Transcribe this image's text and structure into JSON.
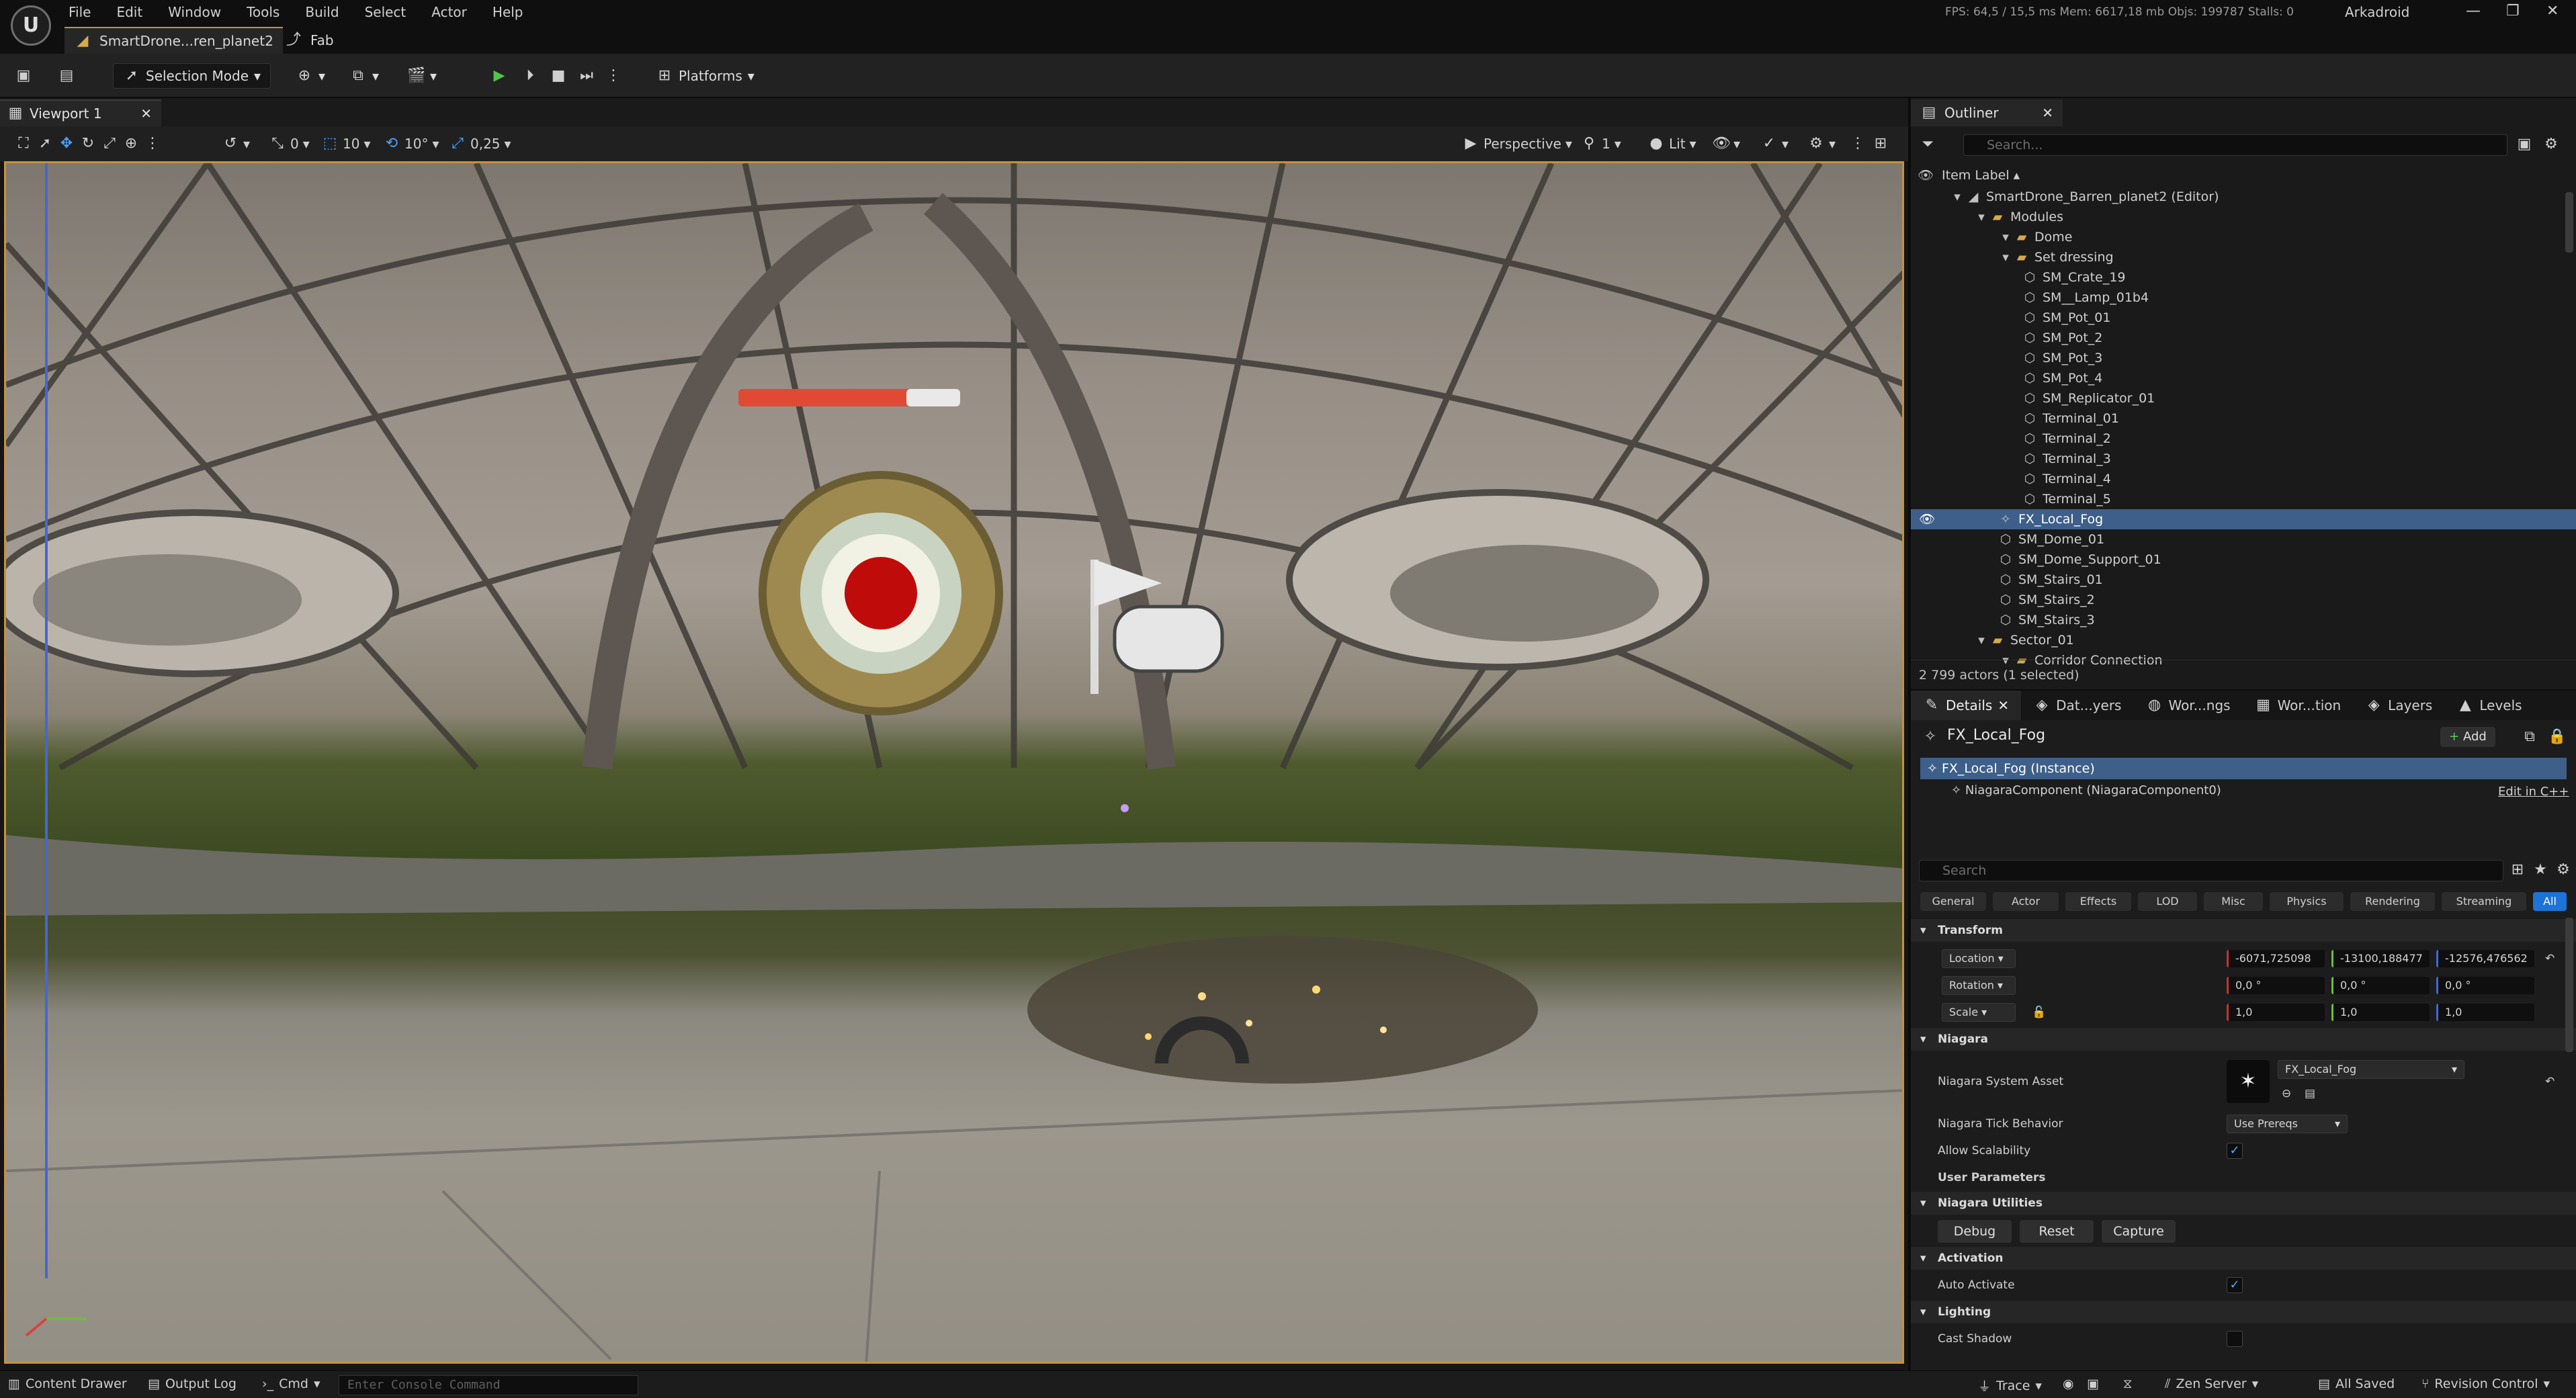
{
  "app": {
    "logo_letter": "U",
    "project": "Arkadroid",
    "stats": "FPS: 64,5  /  15,5 ms  Mem: 6617,18 mb  Objs: 199787  Stalls: 0"
  },
  "menu": [
    "File",
    "Edit",
    "Window",
    "Tools",
    "Build",
    "Select",
    "Actor",
    "Help"
  ],
  "doc_tabs": [
    "SmartDrone...ren_planet2",
    "Fab"
  ],
  "toolbar": {
    "selection_mode": "Selection Mode",
    "platforms": "Platforms"
  },
  "viewport": {
    "tab_label": "Viewport 1",
    "grid_snap": "10",
    "rotation_snap": "10°",
    "scale_snap": "0,25",
    "camera_speed": "1",
    "perspective": "Perspective",
    "lit": "Lit",
    "angle_value": "0"
  },
  "outliner": {
    "tab_label": "Outliner",
    "search_placeholder": "Search...",
    "column_header": "Item Label",
    "actor_count": "2 799 actors (1 selected)",
    "rows": [
      {
        "label": "SmartDrone_Barren_planet2 (Editor)",
        "type": "world",
        "indent": 0
      },
      {
        "label": "Modules",
        "type": "folder",
        "indent": 1
      },
      {
        "label": "Dome",
        "type": "folder",
        "indent": 2
      },
      {
        "label": "Set dressing",
        "type": "folder",
        "indent": 2
      },
      {
        "label": "SM_Crate_19",
        "type": "mesh",
        "indent": 3
      },
      {
        "label": "SM__Lamp_01b4",
        "type": "mesh",
        "indent": 3
      },
      {
        "label": "SM_Pot_01",
        "type": "mesh",
        "indent": 3
      },
      {
        "label": "SM_Pot_2",
        "type": "mesh",
        "indent": 3
      },
      {
        "label": "SM_Pot_3",
        "type": "mesh",
        "indent": 3
      },
      {
        "label": "SM_Pot_4",
        "type": "mesh",
        "indent": 3
      },
      {
        "label": "SM_Replicator_01",
        "type": "mesh",
        "indent": 3
      },
      {
        "label": "Terminal_01",
        "type": "mesh",
        "indent": 3
      },
      {
        "label": "Terminal_2",
        "type": "mesh",
        "indent": 3
      },
      {
        "label": "Terminal_3",
        "type": "mesh",
        "indent": 3
      },
      {
        "label": "Terminal_4",
        "type": "mesh",
        "indent": 3
      },
      {
        "label": "Terminal_5",
        "type": "mesh",
        "indent": 3
      },
      {
        "label": "FX_Local_Fog",
        "type": "fx",
        "indent": 2,
        "selected": true
      },
      {
        "label": "SM_Dome_01",
        "type": "mesh",
        "indent": 2
      },
      {
        "label": "SM_Dome_Support_01",
        "type": "mesh",
        "indent": 2
      },
      {
        "label": "SM_Stairs_01",
        "type": "mesh",
        "indent": 2
      },
      {
        "label": "SM_Stairs_2",
        "type": "mesh",
        "indent": 2
      },
      {
        "label": "SM_Stairs_3",
        "type": "mesh",
        "indent": 2
      },
      {
        "label": "Sector_01",
        "type": "folder",
        "indent": 1
      },
      {
        "label": "Corridor Connection",
        "type": "folder",
        "indent": 2
      }
    ]
  },
  "details": {
    "tabs": [
      "Details",
      "Dat...yers",
      "Wor...ngs",
      "Wor...tion",
      "Layers",
      "Levels"
    ],
    "actor_name": "FX_Local_Fog",
    "add_label": "Add",
    "instance_label": "FX_Local_Fog (Instance)",
    "component_label": "NiagaraComponent (NiagaraComponent0)",
    "edit_cpp": "Edit in C++",
    "search_placeholder": "Search",
    "categories": [
      "General",
      "Actor",
      "Effects",
      "LOD",
      "Misc",
      "Physics",
      "Rendering",
      "Streaming",
      "All"
    ],
    "transform": {
      "section": "Transform",
      "location_label": "Location",
      "location": [
        "-6071,725098",
        "-13100,188477",
        "-12576,476562"
      ],
      "rotation_label": "Rotation",
      "rotation": [
        "0,0 °",
        "0,0 °",
        "0,0 °"
      ],
      "scale_label": "Scale",
      "scale": [
        "1,0",
        "1,0",
        "1,0"
      ]
    },
    "niagara": {
      "section": "Niagara",
      "system_asset_label": "Niagara System Asset",
      "system_asset": "FX_Local_Fog",
      "tick_label": "Niagara Tick Behavior",
      "tick_value": "Use Prereqs",
      "scalability_label": "Allow Scalability",
      "user_params": "User Parameters"
    },
    "utilities": {
      "section": "Niagara Utilities",
      "buttons": [
        "Debug",
        "Reset",
        "Capture"
      ]
    },
    "activation": {
      "section": "Activation",
      "auto_activate": "Auto Activate"
    },
    "lighting": {
      "section": "Lighting",
      "cast_shadow": "Cast Shadow"
    }
  },
  "statusbar": {
    "content_drawer": "Content Drawer",
    "output_log": "Output Log",
    "cmd": "Cmd",
    "console_placeholder": "Enter Console Command",
    "trace": "Trace",
    "zen": "Zen Server",
    "saved": "All Saved",
    "revision": "Revision Control"
  },
  "colors": {
    "accent": "#1c73d8",
    "selection": "#3d5f8a",
    "viewport_border": "#c4923a",
    "play": "#51c44b"
  }
}
